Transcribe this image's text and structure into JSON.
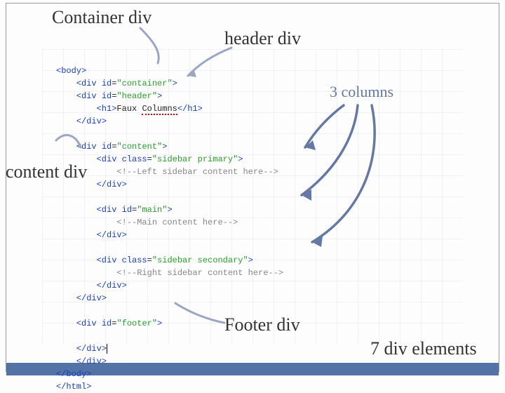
{
  "annotations": {
    "container": "Container div",
    "header": "header div",
    "content": "content div",
    "footer": "Footer div",
    "columns": "3 columns",
    "count": "7 div elements"
  },
  "code": {
    "l1": "<body>",
    "l2_a": "<div",
    "l2_id": "id",
    "l2_v": "\"container\"",
    "l2_b": ">",
    "l3_a": "<div",
    "l3_id": "id",
    "l3_v": "\"header\"",
    "l3_b": ">",
    "l4_a": "<h1>",
    "l4_txt1": "Faux ",
    "l4_txt2": "Columns",
    "l4_b": "</h1>",
    "l5": "</div>",
    "l7_a": "<div",
    "l7_id": "id",
    "l7_v": "\"content\"",
    "l7_b": ">",
    "l8_a": "<div",
    "l8_id": "class",
    "l8_v": "\"sidebar primary\"",
    "l8_b": ">",
    "l9": "<!--Left sidebar content here-->",
    "l10": "</div>",
    "l12_a": "<div",
    "l12_id": "id",
    "l12_v": "\"main\"",
    "l12_b": ">",
    "l13": "<!--Main content here-->",
    "l14": "</div>",
    "l16_a": "<div",
    "l16_id": "class",
    "l16_v": "\"sidebar secondary\"",
    "l16_b": ">",
    "l17": "<!--Right sidebar content here-->",
    "l18": "</div>",
    "l19": "</div>",
    "l21_a": "<div",
    "l21_id": "id",
    "l21_v": "\"footer\"",
    "l21_b": ">",
    "l23": "</div>",
    "l23b": "|",
    "l24": "</div>",
    "l25": "</body>",
    "l26": "</html>"
  }
}
